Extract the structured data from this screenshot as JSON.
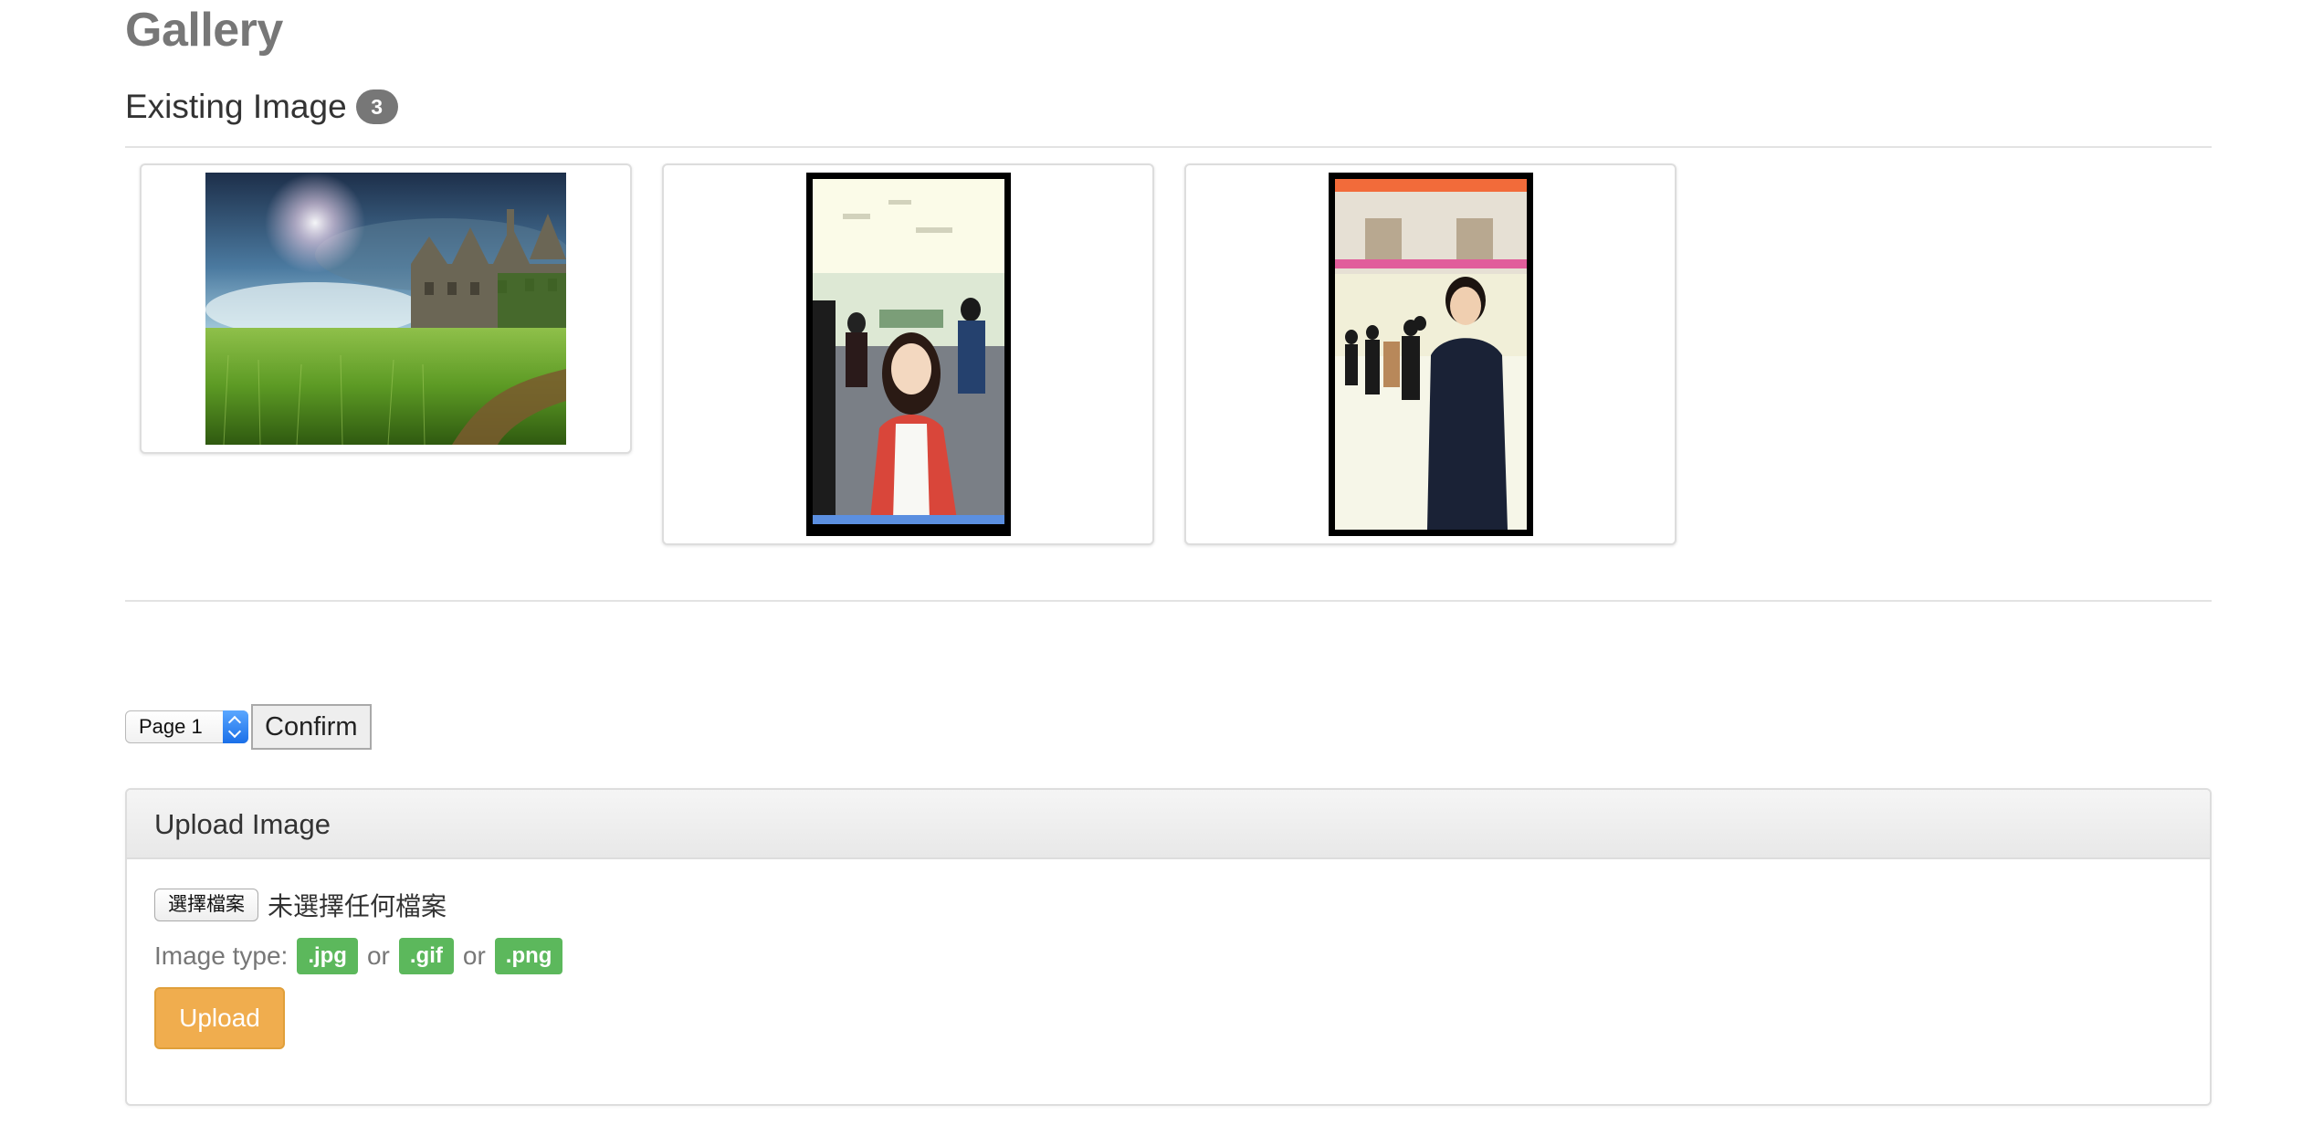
{
  "page": {
    "title": "Gallery"
  },
  "existing": {
    "heading": "Existing Image",
    "count": "3",
    "images": [
      {
        "name": "castle-field-photo"
      },
      {
        "name": "girl-in-office-photo"
      },
      {
        "name": "boy-in-office-photo"
      }
    ]
  },
  "pagination": {
    "selected": "Page 1",
    "confirm_label": "Confirm"
  },
  "upload": {
    "title": "Upload Image",
    "choose_file_label": "選擇檔案",
    "no_file_text": "未選擇任何檔案",
    "type_label": "Image type:",
    "types": [
      ".jpg",
      ".gif",
      ".png"
    ],
    "separator": "or",
    "button_label": "Upload"
  },
  "colors": {
    "badge_gray": "#777777",
    "type_badge_green": "#5cb85c",
    "upload_orange": "#f0ad4e"
  }
}
